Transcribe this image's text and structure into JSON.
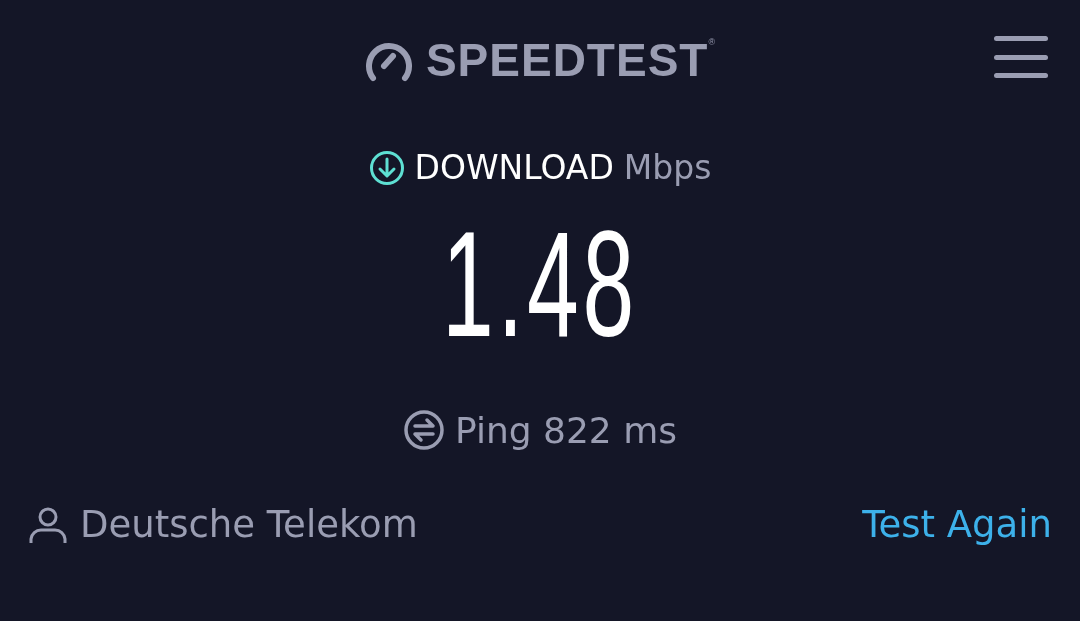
{
  "header": {
    "logo": "SPEEDTEST$^{®}$"
  },
  "result": {
    "label": "DOWNLOAD",
    "unit": "Mbps",
    "value": "1.48"
  },
  "ping": {
    "text": "Ping 822 ms"
  },
  "footer": {
    "provider": "Deutsche Telekom",
    "action": "Test Again"
  }
}
